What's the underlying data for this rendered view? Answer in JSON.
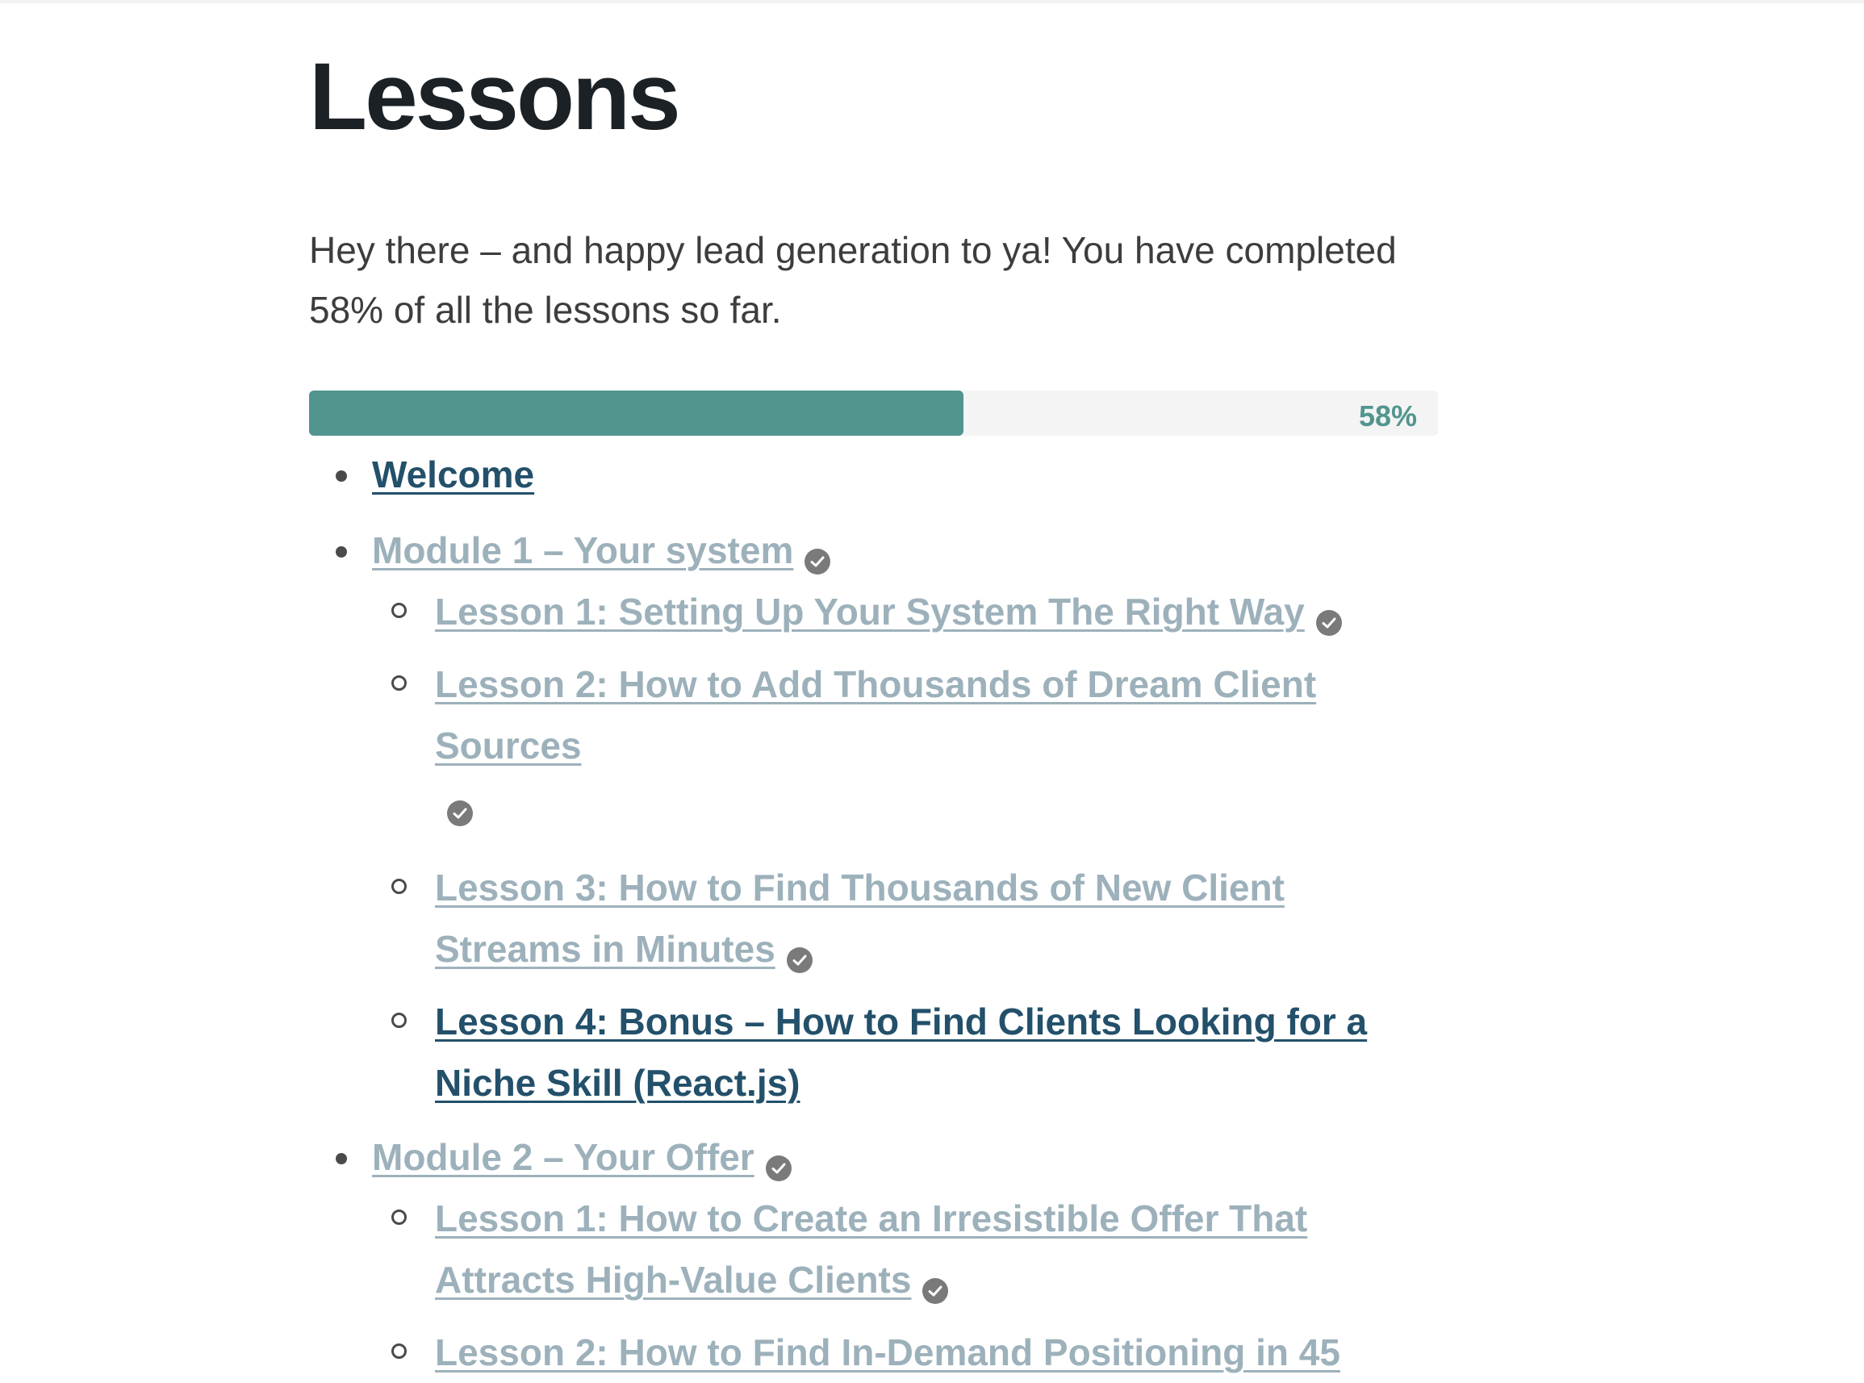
{
  "page": {
    "title": "Lessons",
    "intro": "Hey there – and happy lead generation to ya! You have completed 58% of all the lessons so far."
  },
  "progress": {
    "percent": 58,
    "label": "58%",
    "fill_color": "#52958f",
    "track_color": "#f4f4f4"
  },
  "colors": {
    "completed_link": "#9db1bb",
    "current_link": "#23506a",
    "heading": "#1c2126",
    "check_badge": "#7a7a7a"
  },
  "modules": [
    {
      "label": "Welcome",
      "status": "current"
    },
    {
      "label": "Module 1 – Your system",
      "status": "completed",
      "icon": "check-circle-icon",
      "lessons": [
        {
          "label": "Lesson 1: Setting Up Your System The Right Way",
          "status": "completed"
        },
        {
          "label": "Lesson 2: How to Add Thousands of Dream Client Sources",
          "status": "completed"
        },
        {
          "label": "Lesson 3: How to Find Thousands of New Client Streams in Minutes",
          "status": "completed"
        },
        {
          "label": "Lesson 4: Bonus – How to Find Clients Looking for a Niche Skill (React.js)",
          "status": "current"
        }
      ]
    },
    {
      "label": "Module 2 – Your Offer",
      "status": "completed",
      "icon": "check-circle-icon",
      "lessons": [
        {
          "label": "Lesson 1: How to Create an Irresistible Offer That Attracts High-Value Clients",
          "status": "completed"
        },
        {
          "label": "Lesson 2: How to Find In-Demand Positioning in 45",
          "status": "completed"
        }
      ]
    }
  ]
}
